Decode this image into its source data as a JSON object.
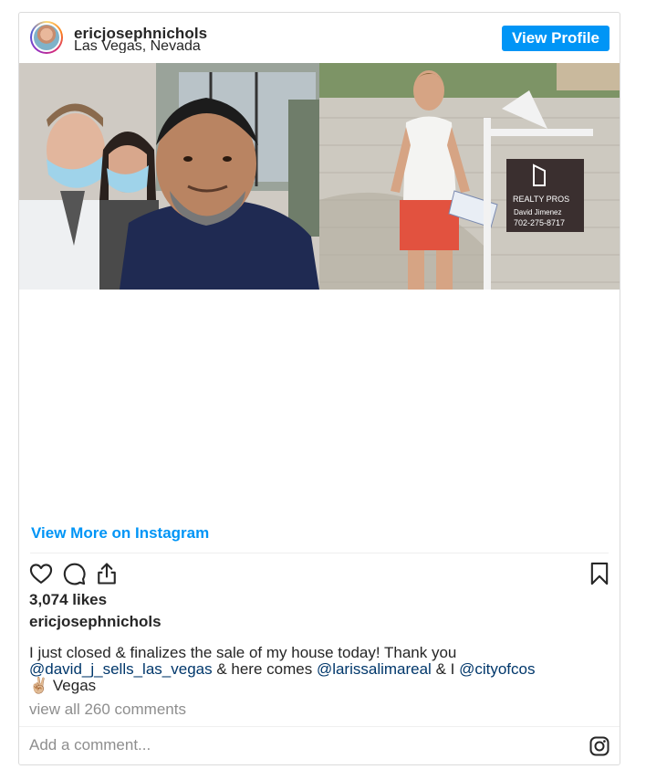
{
  "header": {
    "username": "ericjosephnichols",
    "location": "Las Vegas, Nevada",
    "view_profile_label": "View Profile"
  },
  "media": {
    "sign_brand": "REALTY PROS",
    "sign_agent": "David Jimenez",
    "sign_phone": "702-275-8717"
  },
  "view_more_label": "View More on Instagram",
  "actions": {
    "icons": [
      "heart-icon",
      "comment-icon",
      "share-icon",
      "bookmark-icon"
    ]
  },
  "likes": "3,074 likes",
  "caption": {
    "username": "ericjosephnichols",
    "text_1": "I just closed & finalizes the sale of my house today! Thank you ",
    "mention_1": "@david_j_sells_las_vegas",
    "text_2": " & here comes ",
    "mention_2": "@larissalimareal",
    "text_3": " & I ",
    "mention_3": "@cityofcos",
    "emoji": "✌🏼",
    "text_4": " Vegas"
  },
  "view_comments_label": "view all 260 comments",
  "comment_placeholder": "Add a comment...",
  "colors": {
    "accent": "#0095f6",
    "mention": "#00376b",
    "muted": "#8e8e8e",
    "text": "#262626",
    "border": "#dbdbdb"
  }
}
